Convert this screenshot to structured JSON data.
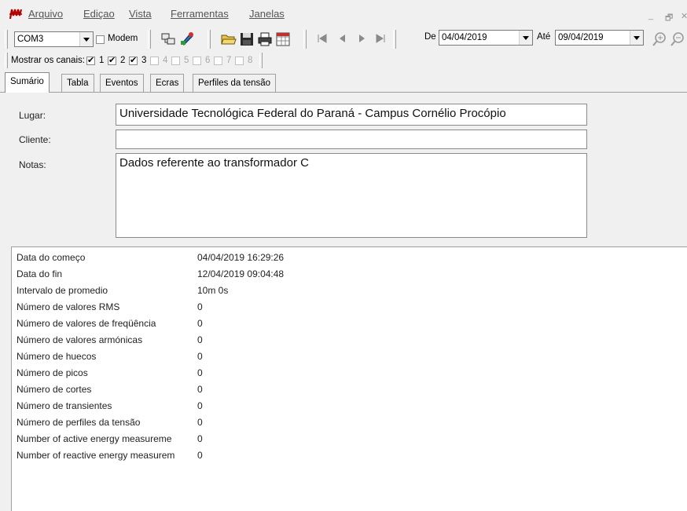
{
  "menu": {
    "items": [
      {
        "label": "Arquivo"
      },
      {
        "label": "Ediçao"
      },
      {
        "label": "Vista"
      },
      {
        "label": "Ferramentas"
      },
      {
        "label": "Janelas"
      }
    ],
    "window_controls": [
      "_",
      "🗗",
      "✕"
    ]
  },
  "toolbar": {
    "port_value": "COM3",
    "modem_label": "Modem",
    "modem_checked": false,
    "date_from_label": "De",
    "date_from_value": "04/04/2019",
    "date_to_label": "Até",
    "date_to_value": "09/04/2019"
  },
  "channels": {
    "label": "Mostrar os canais:",
    "items": [
      {
        "label": "1",
        "checked": true,
        "enabled": true
      },
      {
        "label": "2",
        "checked": true,
        "enabled": true
      },
      {
        "label": "3",
        "checked": true,
        "enabled": true
      },
      {
        "label": "4",
        "checked": false,
        "enabled": false
      },
      {
        "label": "5",
        "checked": false,
        "enabled": false
      },
      {
        "label": "6",
        "checked": false,
        "enabled": false
      },
      {
        "label": "7",
        "checked": false,
        "enabled": false
      },
      {
        "label": "8",
        "checked": false,
        "enabled": false
      }
    ]
  },
  "tabs": [
    {
      "label": "Sumário",
      "active": true
    },
    {
      "label": "Tabla",
      "active": false
    },
    {
      "label": "Eventos",
      "active": false
    },
    {
      "label": "Ecras",
      "active": false
    },
    {
      "label": "Perfiles da tensão",
      "active": false
    }
  ],
  "form": {
    "lugar_label": "Lugar:",
    "lugar_value": "Universidade Tecnológica Federal do Paraná - Campus Cornélio Procópio",
    "cliente_label": "Cliente:",
    "cliente_value": "",
    "notas_label": "Notas:",
    "notas_value": "Dados referente ao transformador C"
  },
  "summary": {
    "rows": [
      {
        "label": "Data do começo",
        "value": "04/04/2019 16:29:26"
      },
      {
        "label": "Data do fin",
        "value": "12/04/2019 09:04:48"
      },
      {
        "label": "Intervalo de promedio",
        "value": "10m 0s"
      },
      {
        "label": "Número de valores RMS",
        "value": "0"
      },
      {
        "label": "Número de valores de freqüência",
        "value": "0"
      },
      {
        "label": "Número de valores armónicas",
        "value": "0"
      },
      {
        "label": "Número de huecos",
        "value": "0"
      },
      {
        "label": "Número de picos",
        "value": "0"
      },
      {
        "label": "Número de cortes",
        "value": "0"
      },
      {
        "label": "Número de transientes",
        "value": "0"
      },
      {
        "label": "Número de perfiles da tensão",
        "value": "0"
      },
      {
        "label": "Number of active energy measureme",
        "value": "0"
      },
      {
        "label": "Number of reactive energy measurem",
        "value": "0"
      }
    ]
  }
}
